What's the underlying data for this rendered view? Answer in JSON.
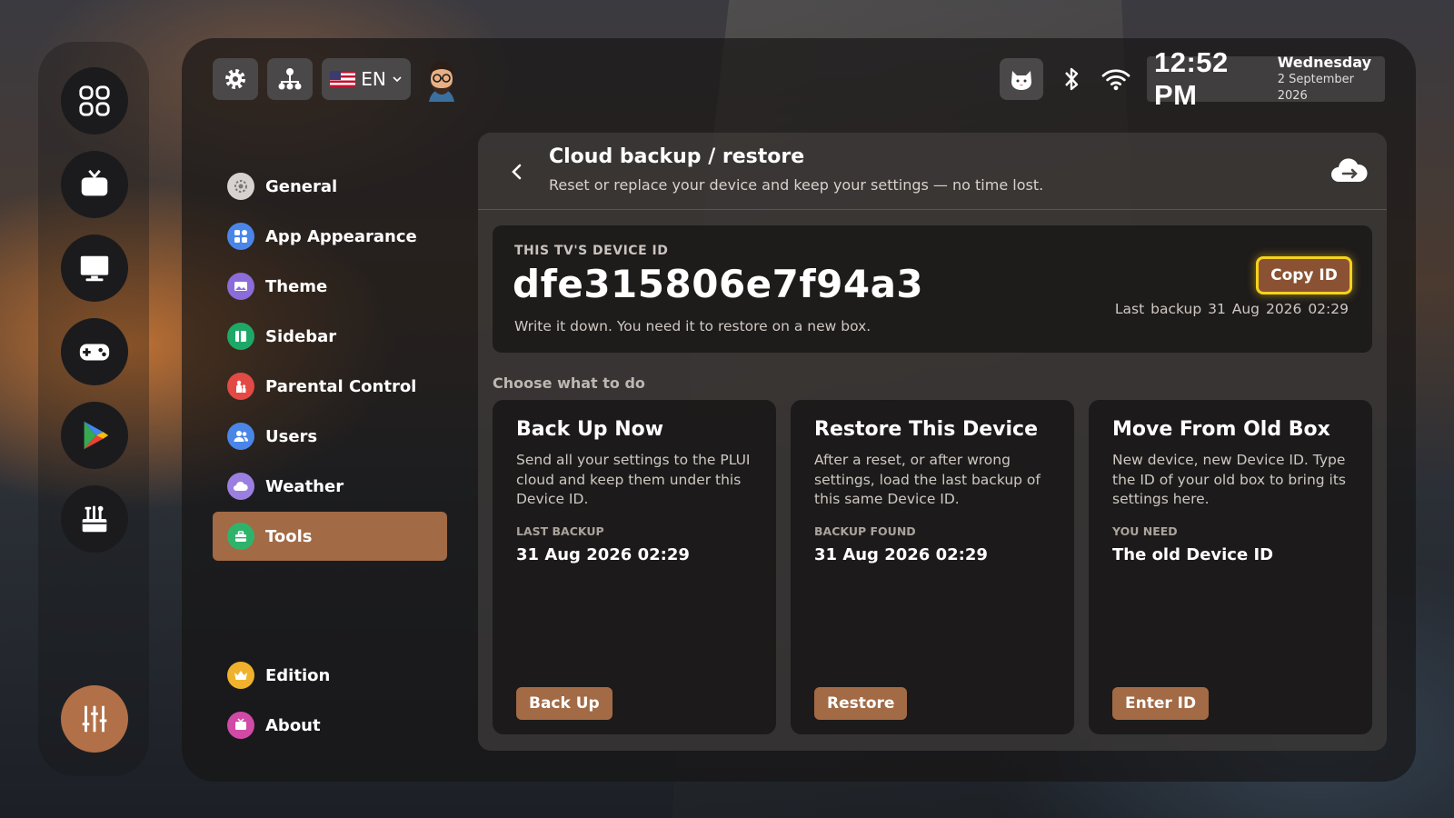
{
  "topbar": {
    "language": "EN",
    "icons": [
      "gear-icon",
      "sitemap-icon",
      "avatar",
      "cat-icon",
      "bluetooth-icon",
      "wifi-icon"
    ]
  },
  "clock": {
    "time": "12:52 PM",
    "day": "Wednesday",
    "date": "2 September 2026"
  },
  "nav": {
    "items": [
      {
        "label": "General",
        "color": "#d7d2ce"
      },
      {
        "label": "App Appearance",
        "color": "#4a86e8"
      },
      {
        "label": "Theme",
        "color": "#8b6cd9"
      },
      {
        "label": "Sidebar",
        "color": "#1ea868"
      },
      {
        "label": "Parental Control",
        "color": "#e34a45"
      },
      {
        "label": "Users",
        "color": "#4a86e8"
      },
      {
        "label": "Weather",
        "color": "#9b7fe0"
      },
      {
        "label": "Tools",
        "color": "#2fb36b"
      },
      {
        "label": "Edition",
        "color": "#f0b12c"
      },
      {
        "label": "About",
        "color": "#d14aa6"
      }
    ],
    "active": "Tools"
  },
  "header": {
    "title": "Cloud backup / restore",
    "subtitle": "Reset or replace your device and keep your settings — no time lost."
  },
  "device": {
    "label": "THIS TV'S DEVICE ID",
    "id": "dfe315806e7f94a3",
    "note": "Write it down. You need it to restore on a new box.",
    "copy_label": "Copy ID",
    "last_backup_label": "Last backup",
    "last_backup_value": "31 Aug 2026 02:29"
  },
  "choose_label": "Choose what to do",
  "cards": [
    {
      "title": "Back Up Now",
      "desc": "Send all your settings to the PLUI cloud and keep them under this Device ID.",
      "meta_label": "LAST BACKUP",
      "meta_value": "31 Aug 2026 02:29",
      "button": "Back Up"
    },
    {
      "title": "Restore This Device",
      "desc": "After a reset, or after wrong settings, load the last backup of this same Device ID.",
      "meta_label": "BACKUP FOUND",
      "meta_value": "31 Aug 2026 02:29",
      "button": "Restore"
    },
    {
      "title": "Move From Old Box",
      "desc": "New device, new Device ID. Type the ID of your old box to bring its settings here.",
      "meta_label": "YOU NEED",
      "meta_value": "The old Device ID",
      "button": "Enter ID"
    }
  ],
  "colors": {
    "accent": "#a26a45",
    "highlight": "#f6d21c"
  }
}
